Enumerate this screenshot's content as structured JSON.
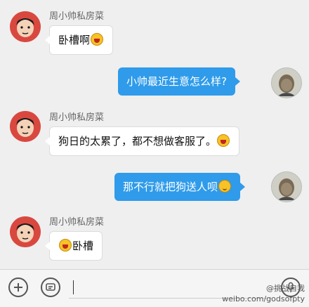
{
  "conversation": {
    "messages": [
      {
        "sender": "周小帅私房菜",
        "text": "卧槽啊"
      },
      {
        "text": "小帅最近生意怎么样?"
      },
      {
        "sender": "周小帅私房菜",
        "text": "狗日的太累了，都不想做客服了。"
      },
      {
        "text": "那不行就把狗送人呗"
      },
      {
        "sender": "周小帅私房菜",
        "text": "卧槽"
      }
    ]
  },
  "toolbar": {
    "add_icon": "plus-circle-icon",
    "emoji_icon": "chat-bubble-icon",
    "voice_icon": "microphone-icon",
    "input_value": ""
  },
  "watermark": {
    "line1": "@挑战自我",
    "line2": "weibo.com/godsofpty"
  },
  "colors": {
    "background": "#efefef",
    "outgoing_bubble": "#2f9bea",
    "incoming_bubble": "#ffffff"
  }
}
